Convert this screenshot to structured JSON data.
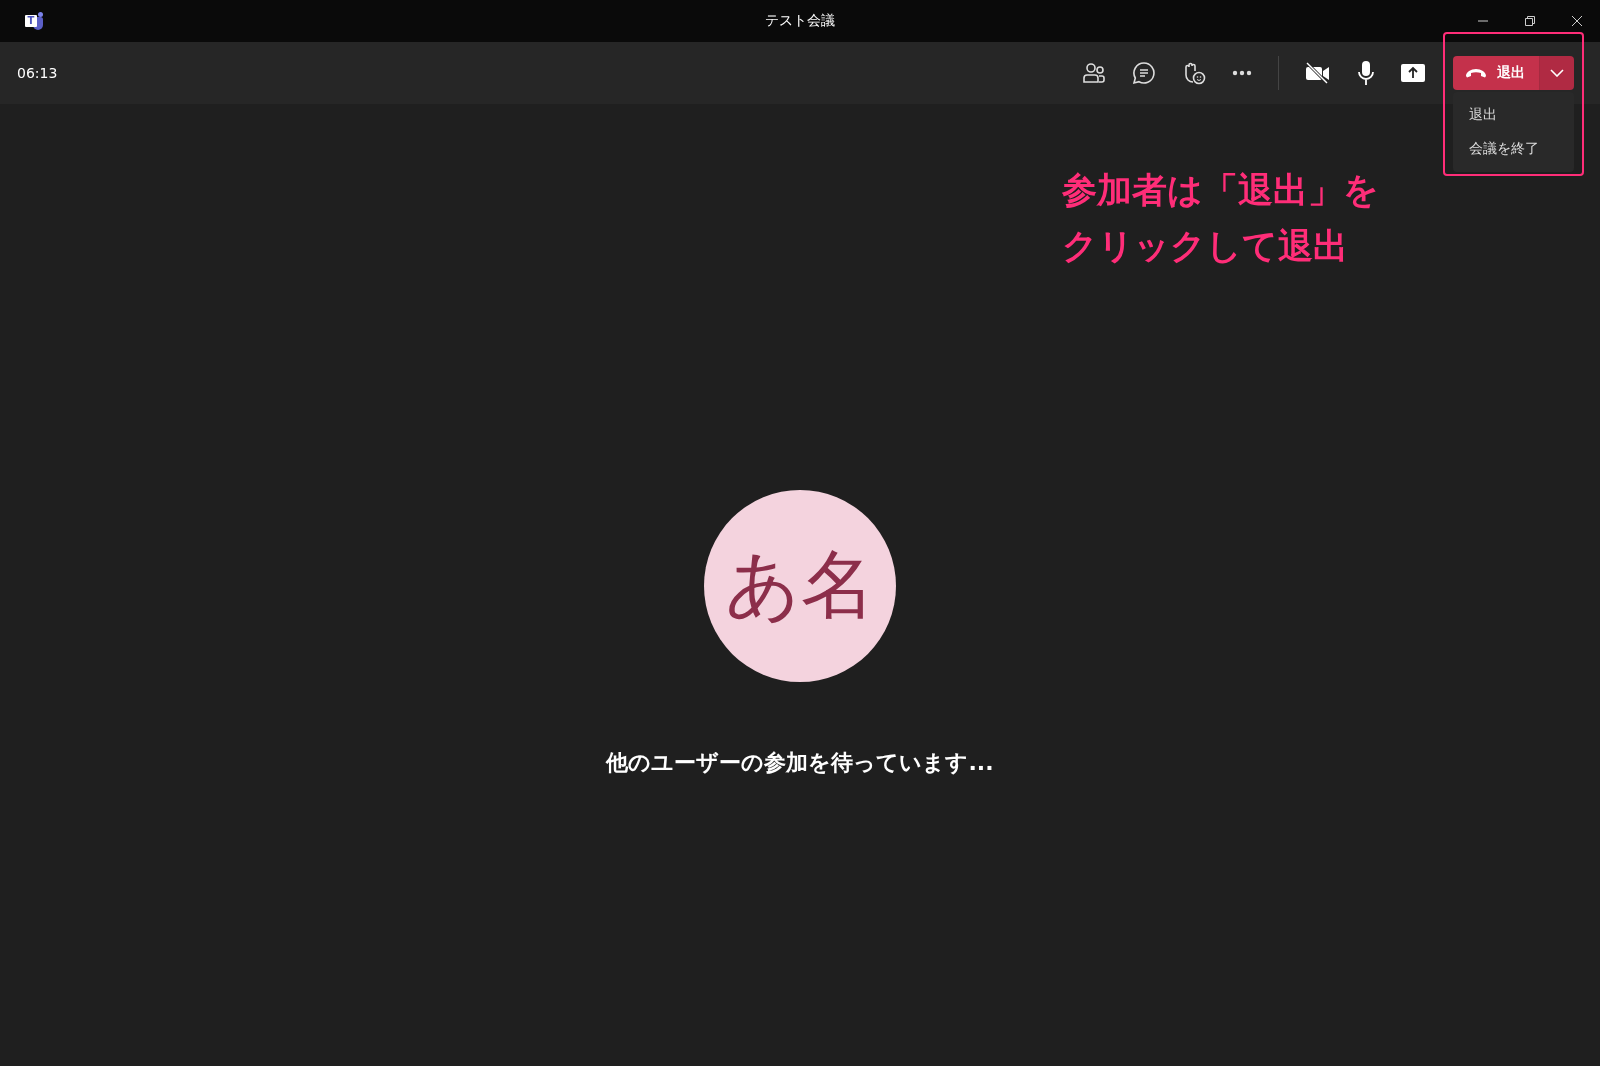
{
  "window": {
    "title": "テスト会議",
    "logo_letter": "T"
  },
  "toolbar": {
    "timer": "06:13",
    "leave_button": {
      "label": "退出"
    },
    "dropdown_expanded": true
  },
  "leave_menu": {
    "items": [
      {
        "label": "退出"
      },
      {
        "label": "会議を終了"
      }
    ]
  },
  "annotation": {
    "lines": [
      "参加者は「退出」を",
      "クリックして退出"
    ]
  },
  "stage": {
    "avatar_initials": "あ名",
    "status": "他のユーザーの参加を待っています..."
  }
}
